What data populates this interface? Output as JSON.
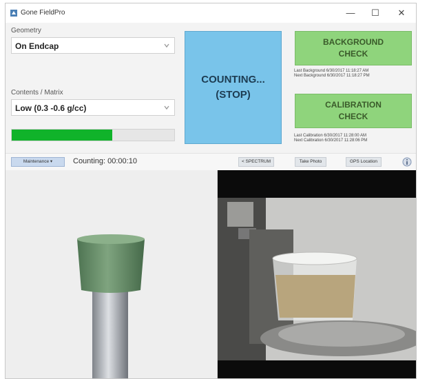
{
  "window": {
    "title": "Gone FieldPro"
  },
  "controls": {
    "minimize": "—",
    "maximize": "☐",
    "close": "✕"
  },
  "geometry": {
    "label": "Geometry",
    "selected": "On Endcap"
  },
  "contents": {
    "label": "Contents / Matrix",
    "selected": "Low (0.3 -0.6 g/cc)"
  },
  "progress": {
    "fraction": 0.62,
    "color": "#10b32a"
  },
  "counting_button": {
    "line1": "COUNTING...",
    "line2": "(STOP)",
    "color": "#79c4ea"
  },
  "background_check": {
    "line1": "BACKGROUND",
    "line2": "CHECK",
    "last": "Last Background 6/30/2017 11:18:27 AM",
    "next": "Next Background 6/30/2017 11:18:27 PM"
  },
  "calibration_check": {
    "line1": "CALIBRATION",
    "line2": "CHECK",
    "last": "Last Calibration 6/30/2017 11:28:00 AM",
    "next": "Next Calibration 6/30/2017 11:28:06 PM"
  },
  "toolbar": {
    "mode_button": "Maintenance ▾",
    "counting_status": "Counting: 00:00:10",
    "spectrum_button": "< SPECTRUM",
    "photo_button": "Take Photo",
    "gps_button": "GPS Location",
    "info_icon": "info-icon"
  },
  "icons": {
    "app": "app-logo-icon",
    "dropdown": "chevron-down-icon"
  }
}
